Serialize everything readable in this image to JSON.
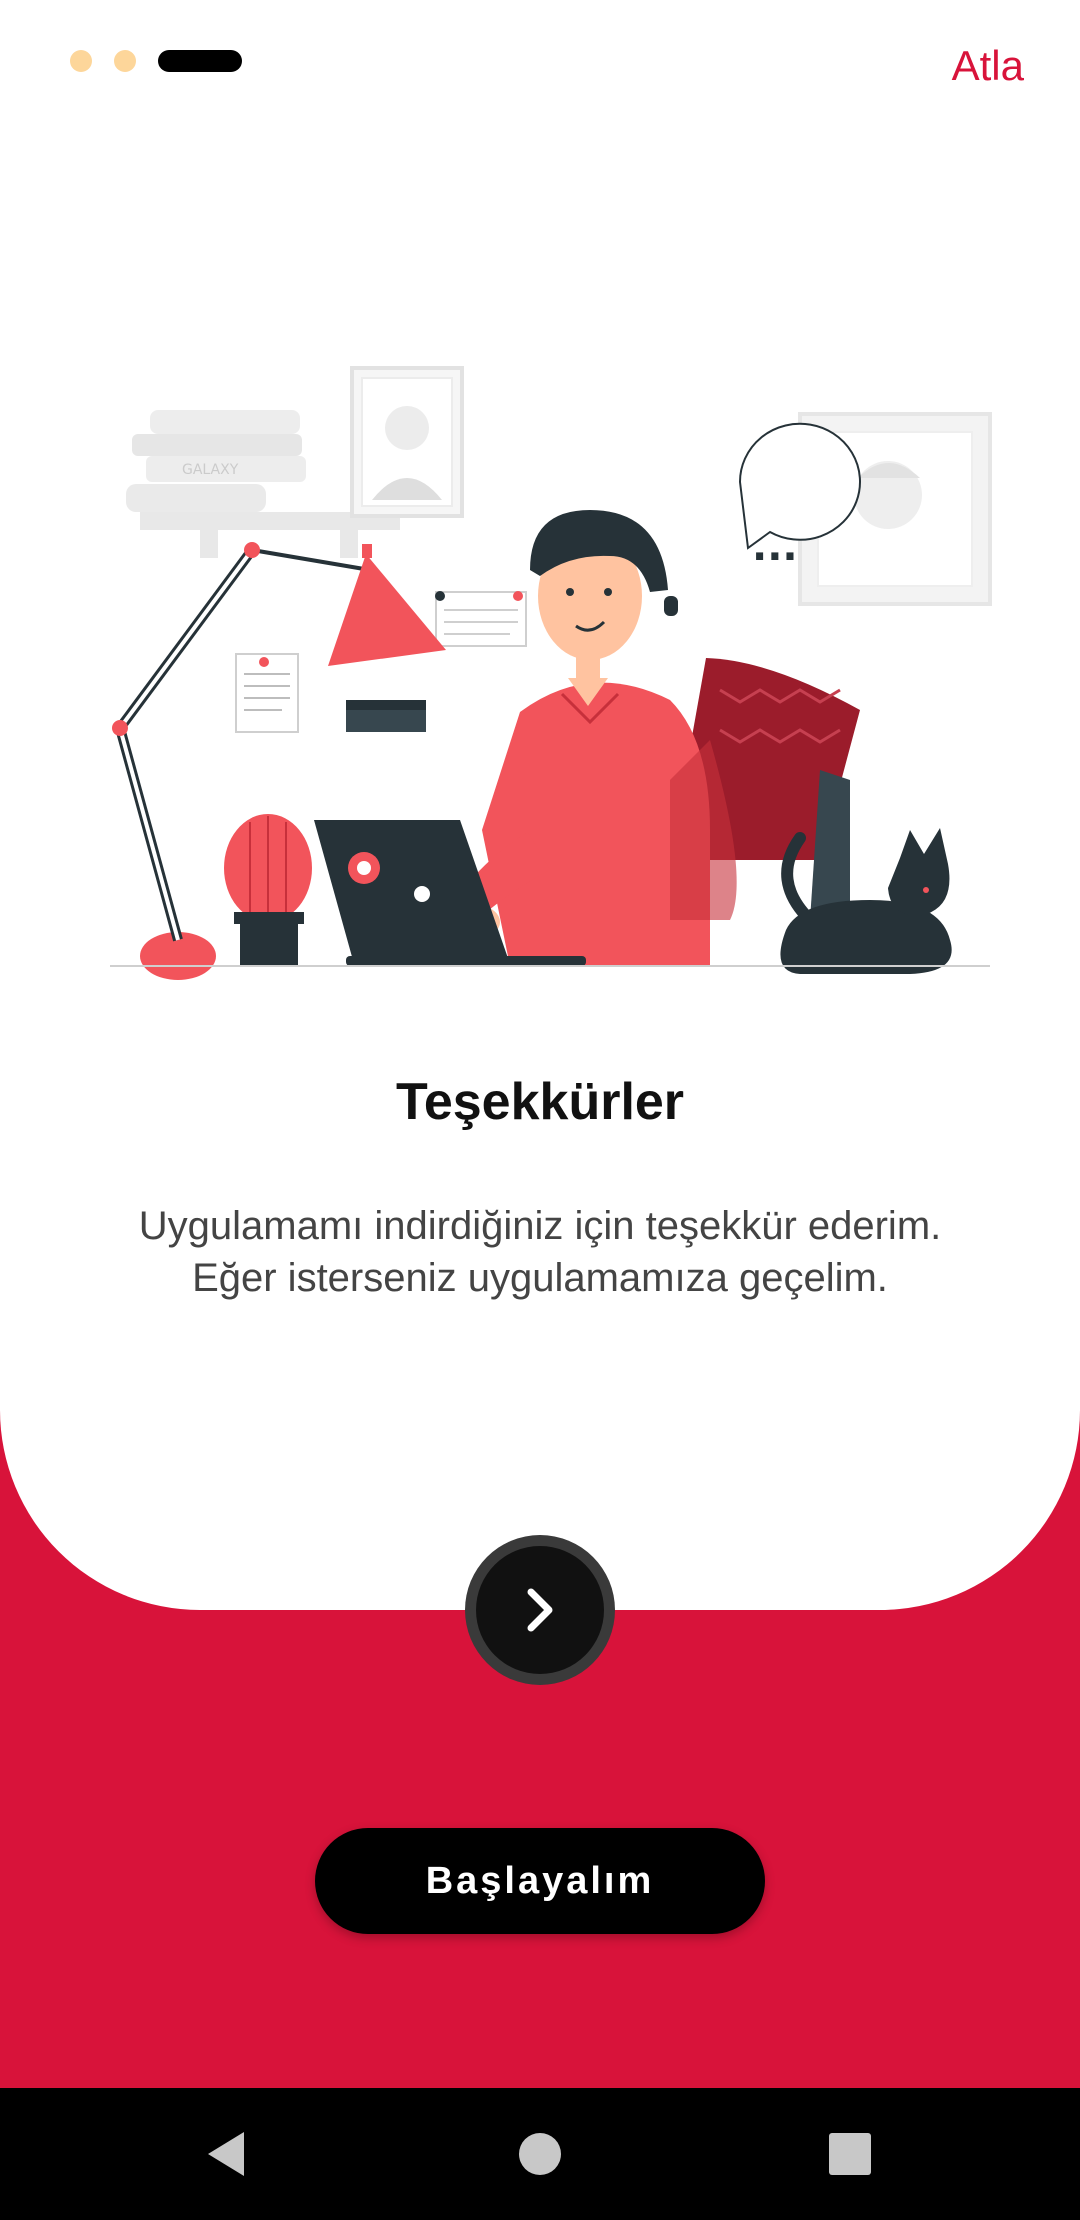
{
  "onboarding": {
    "skip_label": "Atla",
    "title": "Teşekkürler",
    "description_line1": "Uygulamamı indirdiğiniz için teşekkür ederim.",
    "description_line2": "Eğer isterseniz uygulamamıza geçelim.",
    "start_label": "Başlayalım",
    "page_indicator": {
      "total": 3,
      "current": 3
    }
  },
  "illustration": {
    "book_spine_text": "GALAXY",
    "speech_bubble_text": "..."
  },
  "colors": {
    "accent": "#d8133a",
    "indicator_dot": "#fdd69a",
    "illustration_red": "#f2545b",
    "illustration_dark": "#263238"
  },
  "icons": {
    "next": "chevron-right-icon",
    "nav_back": "triangle-back-icon",
    "nav_home": "circle-home-icon",
    "nav_recents": "square-recents-icon"
  }
}
